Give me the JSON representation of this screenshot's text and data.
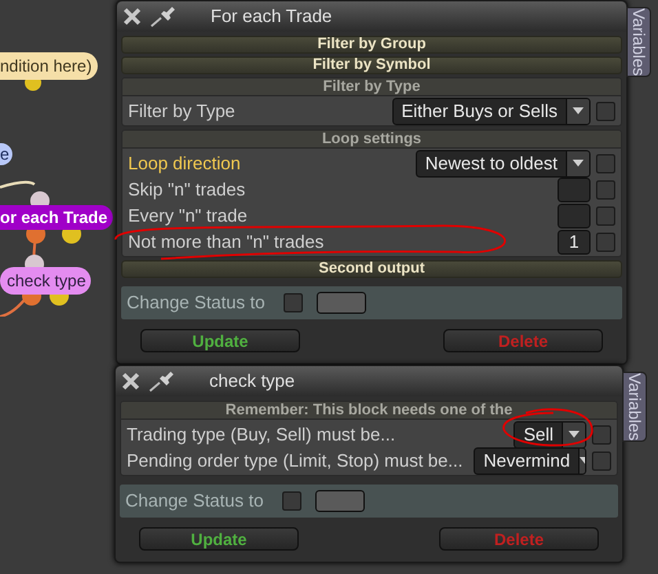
{
  "canvas": {
    "nodes": [
      {
        "label": "ndition here)",
        "color": "#f5dfa8"
      },
      {
        "label": "e",
        "color": "#b8c8f8"
      },
      {
        "label": "or each Trade",
        "color": "#a000c8"
      },
      {
        "label": "check type",
        "color": "#e48cf0"
      }
    ]
  },
  "windows": [
    {
      "title": "For each Trade",
      "tab": "Variables",
      "sections": [
        {
          "title": "Filter by Group",
          "expanded": false
        },
        {
          "title": "Filter by Symbol",
          "expanded": false
        },
        {
          "title": "Filter by Type",
          "expanded": true,
          "rows": [
            {
              "kind": "dropdown",
              "label": "Filter by Type",
              "value": "Either Buys or Sells",
              "highlighted": false,
              "checked": false
            }
          ]
        },
        {
          "title": "Loop settings",
          "expanded": true,
          "rows": [
            {
              "kind": "dropdown",
              "label": "Loop direction",
              "value": "Newest to oldest",
              "highlighted": true,
              "checked": false
            },
            {
              "kind": "number",
              "label": "Skip \"n\" trades",
              "highlighted": false,
              "checked": false
            },
            {
              "kind": "number",
              "label": "Every \"n\" trade",
              "highlighted": false,
              "checked": false
            },
            {
              "kind": "number",
              "label": "Not more than \"n\" trades",
              "value": "1",
              "highlighted": false,
              "checked": false
            }
          ]
        },
        {
          "title": "Second output",
          "expanded": false
        }
      ],
      "status": {
        "label": "Change Status to",
        "checked": false
      },
      "buttons": [
        {
          "label": "Update",
          "kind": "update"
        },
        {
          "label": "Delete",
          "kind": "delete"
        }
      ]
    },
    {
      "title": "check type",
      "tab": "Variables",
      "sections": [
        {
          "title": "Remember: This block needs one of the",
          "expanded": true,
          "rows": [
            {
              "kind": "dropdown",
              "label": "Trading type (Buy, Sell) must be...",
              "value": "Sell",
              "highlighted": false,
              "checked": false
            },
            {
              "kind": "dropdown",
              "label": "Pending order type (Limit, Stop) must be...",
              "value": "Nevermind",
              "highlighted": false,
              "checked": false
            }
          ]
        }
      ],
      "status": {
        "label": "Change Status to",
        "checked": false
      },
      "buttons": [
        {
          "label": "Update",
          "kind": "update"
        },
        {
          "label": "Delete",
          "kind": "delete"
        }
      ]
    }
  ]
}
